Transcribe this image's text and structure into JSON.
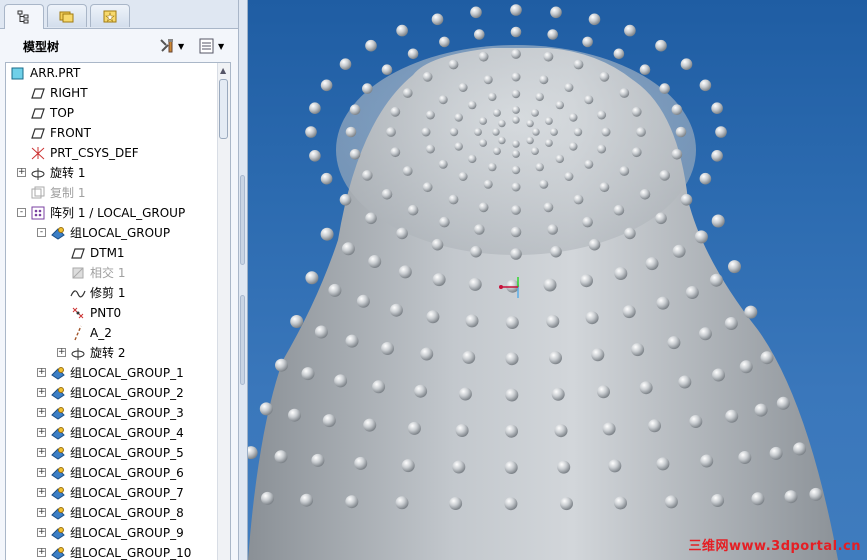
{
  "tabs": [
    {
      "name": "model-tree",
      "icon": "tree-structure-icon"
    },
    {
      "name": "folder-browser",
      "icon": "folders-icon"
    },
    {
      "name": "favorites",
      "icon": "star-folder-icon"
    }
  ],
  "header": {
    "title": "模型树",
    "settings_icon": "tools-icon",
    "show_icon": "list-options-icon"
  },
  "tree": {
    "items": [
      {
        "label": "ARR.PRT",
        "icon": "part-icon"
      },
      {
        "label": "RIGHT",
        "icon": "datum-plane-icon"
      },
      {
        "label": "TOP",
        "icon": "datum-plane-icon"
      },
      {
        "label": "FRONT",
        "icon": "datum-plane-icon"
      },
      {
        "label": "PRT_CSYS_DEF",
        "icon": "csys-icon"
      },
      {
        "label": "旋转 1",
        "icon": "revolve-icon"
      },
      {
        "label": "复制 1",
        "icon": "copy-icon"
      },
      {
        "label": "阵列 1 / LOCAL_GROUP",
        "icon": "pattern-icon"
      },
      {
        "label": "组LOCAL_GROUP",
        "icon": "group-icon"
      },
      {
        "label": "DTM1",
        "icon": "datum-plane-icon"
      },
      {
        "label": "相交 1",
        "icon": "intersect-icon"
      },
      {
        "label": "修剪 1",
        "icon": "curve-icon"
      },
      {
        "label": "PNT0",
        "icon": "datum-point-icon"
      },
      {
        "label": "A_2",
        "icon": "axis-icon"
      },
      {
        "label": "旋转 2",
        "icon": "revolve-icon"
      },
      {
        "label": "组LOCAL_GROUP_1",
        "icon": "group-icon"
      },
      {
        "label": "组LOCAL_GROUP_2",
        "icon": "group-icon"
      },
      {
        "label": "组LOCAL_GROUP_3",
        "icon": "group-icon"
      },
      {
        "label": "组LOCAL_GROUP_4",
        "icon": "group-icon"
      },
      {
        "label": "组LOCAL_GROUP_5",
        "icon": "group-icon"
      },
      {
        "label": "组LOCAL_GROUP_6",
        "icon": "group-icon"
      },
      {
        "label": "组LOCAL_GROUP_7",
        "icon": "group-icon"
      },
      {
        "label": "组LOCAL_GROUP_8",
        "icon": "group-icon"
      },
      {
        "label": "组LOCAL_GROUP_9",
        "icon": "group-icon"
      },
      {
        "label": "组LOCAL_GROUP_10",
        "icon": "group-icon"
      }
    ]
  },
  "viewport": {
    "background": "#2c6bb0",
    "model_color": "#b6bcc2",
    "watermark": "三维网www.3dportal.cn"
  }
}
